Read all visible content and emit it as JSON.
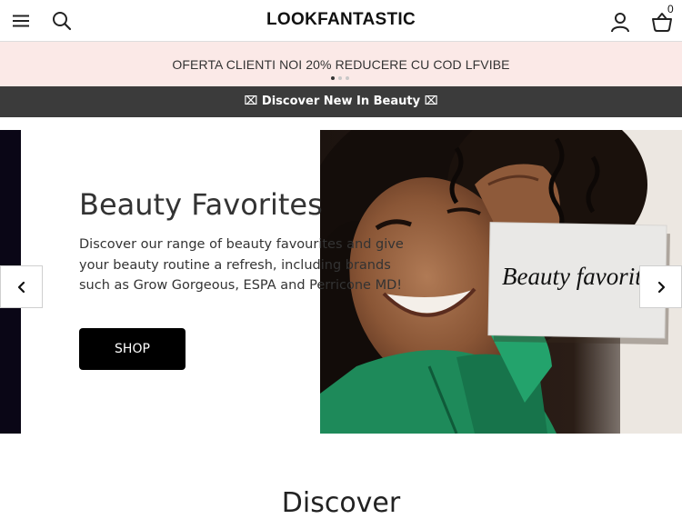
{
  "header": {
    "logo": "LOOKFANTASTIC",
    "basket_count": "0",
    "icons": [
      "menu-icon",
      "search-icon",
      "account-icon",
      "basket-icon"
    ]
  },
  "promo": {
    "text": "OFERTA CLIENTI NOI 20% REDUCERE CU COD LFVIBE",
    "slides_total": 3,
    "active_slide": 1
  },
  "banner": {
    "text": "⌧ Discover New In Beauty ⌧"
  },
  "hero": {
    "title": "Beauty Favorites",
    "description": "Discover our range of beauty favourites and give your beauty routine a refresh, including brands such as Grow Gorgeous, ESPA and Perricone MD!",
    "cta_label": "SHOP",
    "image_card_text": "Beauty favorites",
    "left_edge_color": "#0a0616"
  },
  "section": {
    "heading": "Discover"
  },
  "colors": {
    "promo_bg": "#fbe9e7",
    "banner_bg": "#3b3b3b",
    "button_bg": "#000000",
    "jacket_green": "#1e8a5a"
  }
}
